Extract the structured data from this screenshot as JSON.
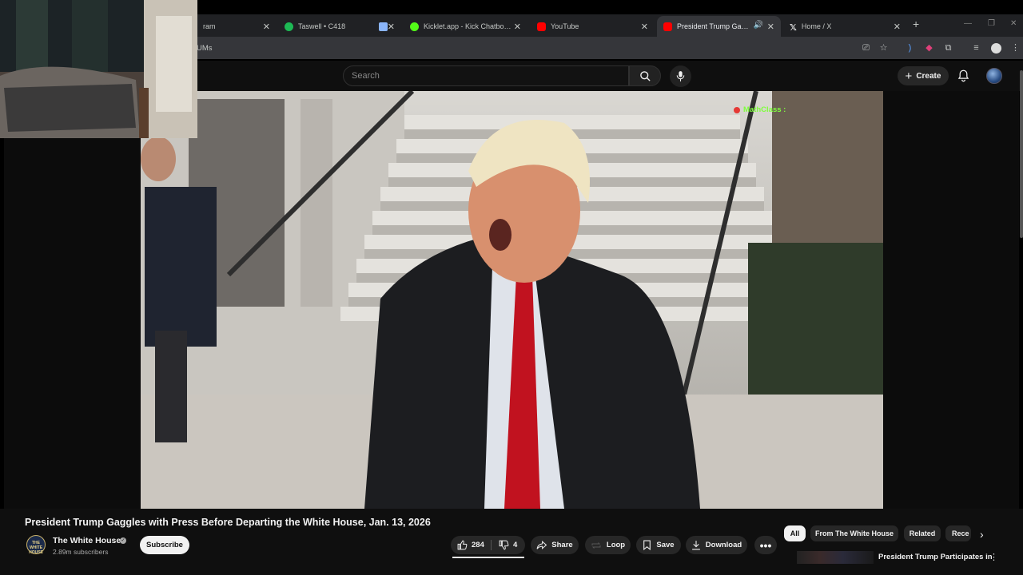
{
  "browser": {
    "tabs": [
      {
        "title": "ram",
        "icon": "tab-icon",
        "color": "#8a8a8a"
      },
      {
        "title": "Taswell • C418",
        "icon": "spotify-icon",
        "color": "#1db954"
      },
      {
        "title": "",
        "icon": "screen-icon",
        "color": "#8ab4f8"
      },
      {
        "title": "Kicklet.app - Kick Chatbot and",
        "icon": "kicklet-icon",
        "color": "#53fc18"
      },
      {
        "title": "YouTube",
        "icon": "youtube-icon",
        "color": "#ff0000"
      },
      {
        "title": "President Trump Gaggles w",
        "icon": "youtube-icon",
        "color": "#ff0000"
      },
      {
        "title": "Home / X",
        "icon": "x-icon",
        "color": "#ffffff"
      }
    ],
    "address_text": "UMs"
  },
  "youtube": {
    "search_placeholder": "Search",
    "create_label": "Create"
  },
  "video": {
    "chat_overlay_user": "MathClass :",
    "title": "President Trump Gaggles with Press Before Departing the White House, Jan. 13, 2026",
    "channel_name": "The White House",
    "channel_avatar_text": "THE WHITE HOUSE",
    "subscribers": "2.89m subscribers",
    "subscribe_label": "Subscribe",
    "likes": "284",
    "dislikes": "4",
    "actions": {
      "share": "Share",
      "loop": "Loop",
      "save": "Save",
      "download": "Download"
    }
  },
  "recommendations": {
    "chips": [
      "All",
      "From The White House",
      "Related",
      "Rece"
    ],
    "first_title": "President Trump Participates in"
  },
  "colors": {
    "background": "#0f0f0f",
    "chip_bg": "#272727",
    "accent_red": "#ff0000",
    "chat_green": "#7fff3d"
  }
}
